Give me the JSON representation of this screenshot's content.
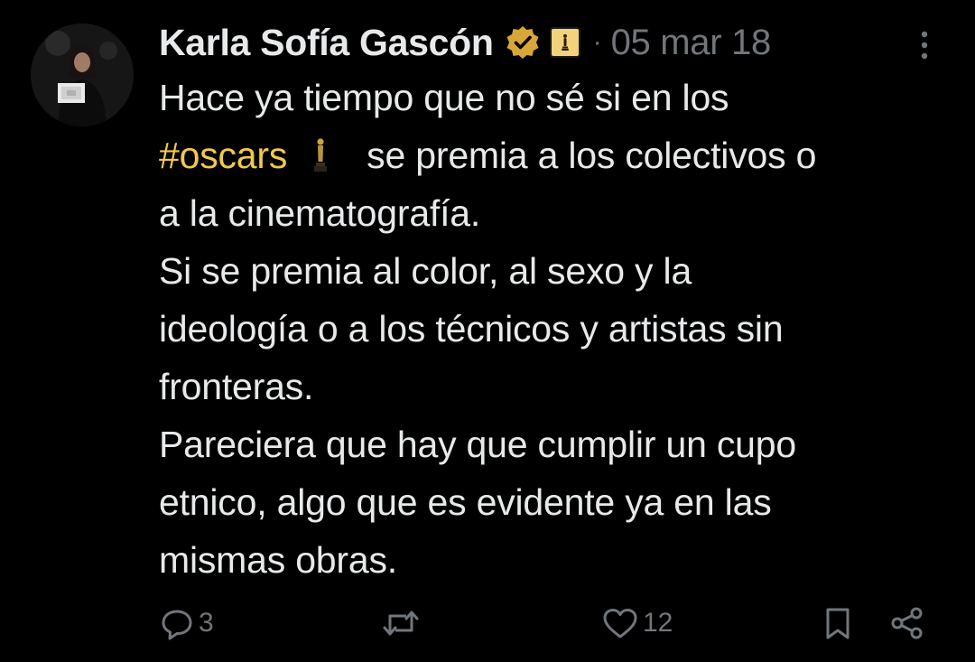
{
  "tweet": {
    "author_name": "Karla Sofía Gascón",
    "separator": "·",
    "date": "05 mar 18",
    "lines": [
      "Hace ya tiempo que no sé si en los",
      "se premia a los colectivos o",
      "a la cinematografía.",
      "Si se premia al color, al sexo y la",
      "ideología o a los técnicos y artistas sin",
      "fronteras.",
      "Pareciera que hay que cumplir un cupo",
      "etnico, algo que es evidente ya en las",
      "mismas obras."
    ],
    "hashtag": "#oscars",
    "emoji": "oscar-trophy-emoji"
  },
  "badges": {
    "verified_icon": "verified-badge-icon",
    "verified_color": "#d9a63a",
    "affiliate_icon": "affiliate-badge-icon"
  },
  "actions": {
    "reply_count": "3",
    "retweet_count": "",
    "like_count": "12"
  },
  "colors": {
    "background": "#000000",
    "text": "#e7e9ea",
    "muted": "#71767b",
    "hashtag": "#f2c94c"
  }
}
